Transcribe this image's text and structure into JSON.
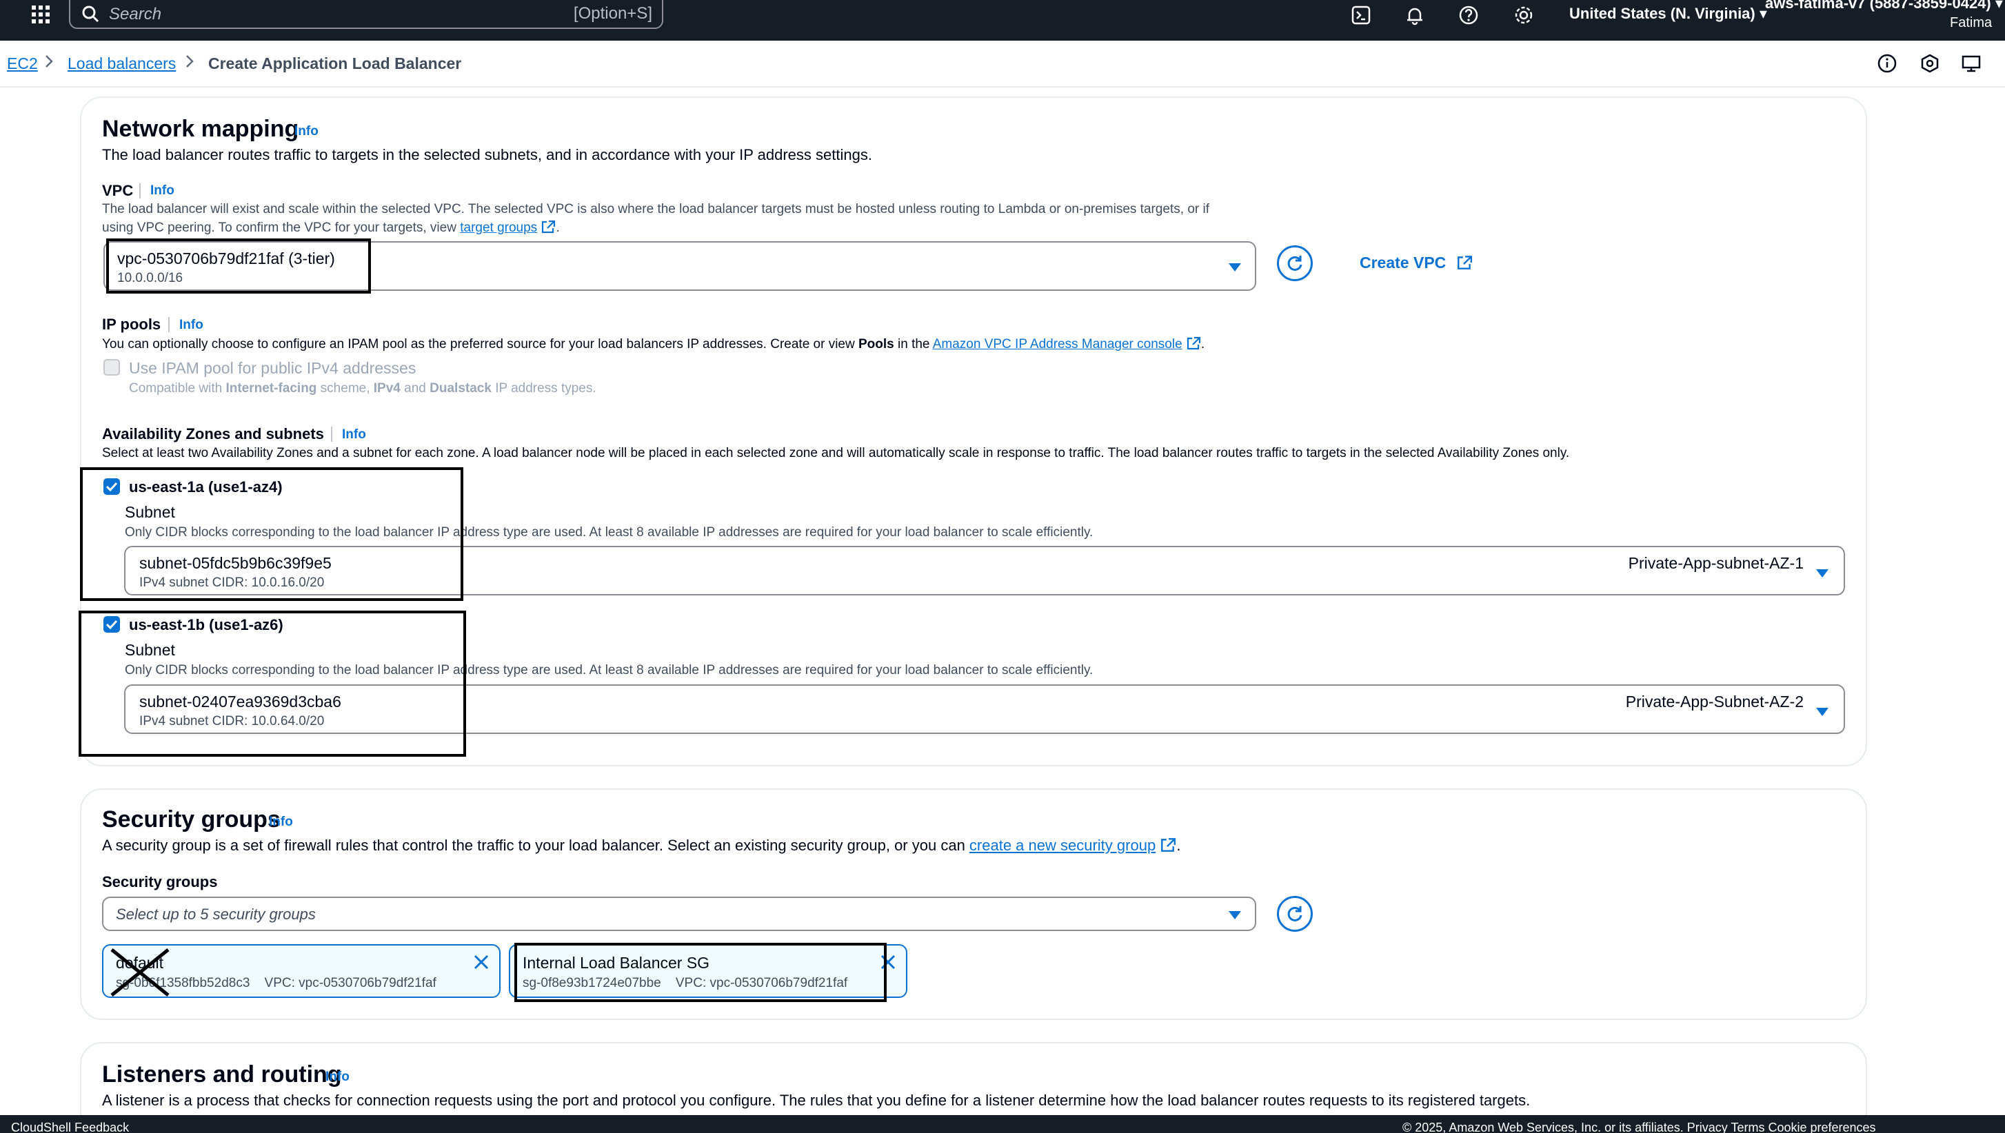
{
  "topnav": {
    "search_placeholder": "Search",
    "search_shortcut": "[Option+S]",
    "region": "United States (N. Virginia)",
    "account": "aws-fatima-v7 (5887-3859-0424)",
    "username": "Fatima"
  },
  "breadcrumb": {
    "items": [
      "EC2",
      "Load balancers"
    ],
    "current": "Create Application Load Balancer"
  },
  "network_mapping": {
    "title": "Network mapping",
    "info": "Info",
    "description": "The load balancer routes traffic to targets in the selected subnets, and in accordance with your IP address settings.",
    "vpc": {
      "label": "VPC",
      "info": "Info",
      "help_line1": "The load balancer will exist and scale within the selected VPC. The selected VPC is also where the load balancer targets must be hosted unless routing to Lambda or on-premises targets, or if",
      "help_line2_pre": "using VPC peering. To confirm the VPC for your targets, view ",
      "help_link": "target groups",
      "help_line2_post": ".",
      "selected_id": "vpc-0530706b79df21faf (3-tier)",
      "selected_cidr": "10.0.0.0/16",
      "create_label": "Create VPC"
    },
    "ip_pools": {
      "label": "IP pools",
      "info": "Info",
      "help_pre": "You can optionally choose to configure an IPAM pool as the preferred source for your load balancers IP addresses. Create or view ",
      "help_bold": "Pools",
      "help_mid": " in the ",
      "help_link": "Amazon VPC IP Address Manager console",
      "help_post": ".",
      "checkbox_label": "Use IPAM pool for public IPv4 addresses",
      "compat_1": "Compatible with ",
      "compat_b1": "Internet-facing",
      "compat_2": " scheme, ",
      "compat_b2": "IPv4",
      "compat_3": " and ",
      "compat_b3": "Dualstack",
      "compat_4": " IP address types."
    },
    "az": {
      "label": "Availability Zones and subnets",
      "info": "Info",
      "help": "Select at least two Availability Zones and a subnet for each zone. A load balancer node will be placed in each selected zone and will automatically scale in response to traffic. The load balancer routes traffic to targets in the selected Availability Zones only.",
      "zones": [
        {
          "name": "us-east-1a (use1-az4)",
          "subnet_label": "Subnet",
          "subnet_help": "Only CIDR blocks corresponding to the load balancer IP address type are used. At least 8 available IP addresses are required for your load balancer to scale efficiently.",
          "subnet_id": "subnet-05fdc5b9b6c39f9e5",
          "subnet_cidr": "IPv4 subnet CIDR: 10.0.16.0/20",
          "subnet_name": "Private-App-subnet-AZ-1"
        },
        {
          "name": "us-east-1b (use1-az6)",
          "subnet_label": "Subnet",
          "subnet_help": "Only CIDR blocks corresponding to the load balancer IP address type are used. At least 8 available IP addresses are required for your load balancer to scale efficiently.",
          "subnet_id": "subnet-02407ea9369d3cba6",
          "subnet_cidr": "IPv4 subnet CIDR: 10.0.64.0/20",
          "subnet_name": "Private-App-Subnet-AZ-2"
        }
      ]
    }
  },
  "security_groups": {
    "title": "Security groups",
    "info": "Info",
    "description_pre": "A security group is a set of firewall rules that control the traffic to your load balancer. Select an existing security group, or you can ",
    "description_link": "create a new security group",
    "description_post": ".",
    "field_label": "Security groups",
    "placeholder": "Select up to 5 security groups",
    "tokens": [
      {
        "name": "default",
        "id": "sg-0b6f1358fbb52d8c3",
        "vpc": "VPC: vpc-0530706b79df21faf"
      },
      {
        "name": "Internal Load Balancer SG",
        "id": "sg-0f8e93b1724e07bbe",
        "vpc": "VPC: vpc-0530706b79df21faf"
      }
    ]
  },
  "listeners": {
    "title": "Listeners and routing",
    "info": "Info",
    "description": "A listener is a process that checks for connection requests using the port and protocol you configure. The rules that you define for a listener determine how the load balancer routes requests to its registered targets."
  },
  "footer": {
    "left": "CloudShell   Feedback",
    "right": "© 2025, Amazon Web Services, Inc. or its affiliates.   Privacy   Terms   Cookie preferences"
  },
  "colors": {
    "nav_bg": "#161d26",
    "link": "#0972d3",
    "text": "#000716",
    "token_bg": "#f0fbff"
  }
}
